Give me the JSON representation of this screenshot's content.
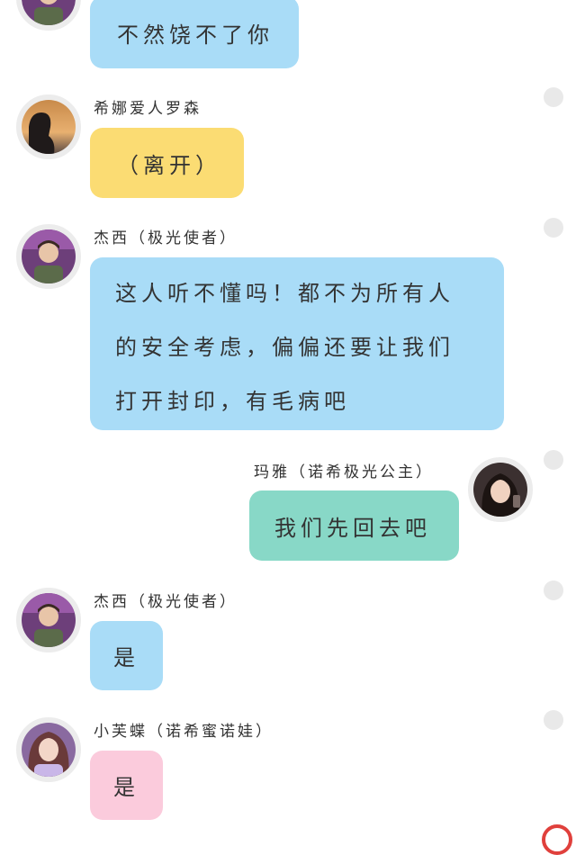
{
  "messages": [
    {
      "sender": "",
      "text": "不然饶不了你",
      "side": "left",
      "color": "#a9dcf7",
      "avatar_icon": "boy-avatar-icon"
    },
    {
      "sender": "希娜爱人罗森",
      "text": "（离开）",
      "side": "left",
      "color": "#fbdc73",
      "avatar_icon": "sunset-silhouette-avatar-icon"
    },
    {
      "sender": "杰西（极光使者）",
      "lines": [
        "这人听不懂吗！都不为所有人",
        "的安全考虑，偏偏还要让我们",
        "打开封印，有毛病吧"
      ],
      "side": "left",
      "color": "#a9dcf7",
      "avatar_icon": "boy-avatar-icon"
    },
    {
      "sender": "玛雅（诺希极光公主）",
      "text": "我们先回去吧",
      "side": "right",
      "color": "#88d8c7",
      "avatar_icon": "girl-avatar-icon"
    },
    {
      "sender": "杰西（极光使者）",
      "text": "是",
      "side": "left",
      "color": "#a9dcf7",
      "avatar_icon": "boy-avatar-icon"
    },
    {
      "sender": "小芙蝶（诺希蜜诺娃）",
      "text": "是",
      "side": "left",
      "color": "#fbcbdc",
      "avatar_icon": "pink-hair-girl-avatar-icon"
    }
  ]
}
